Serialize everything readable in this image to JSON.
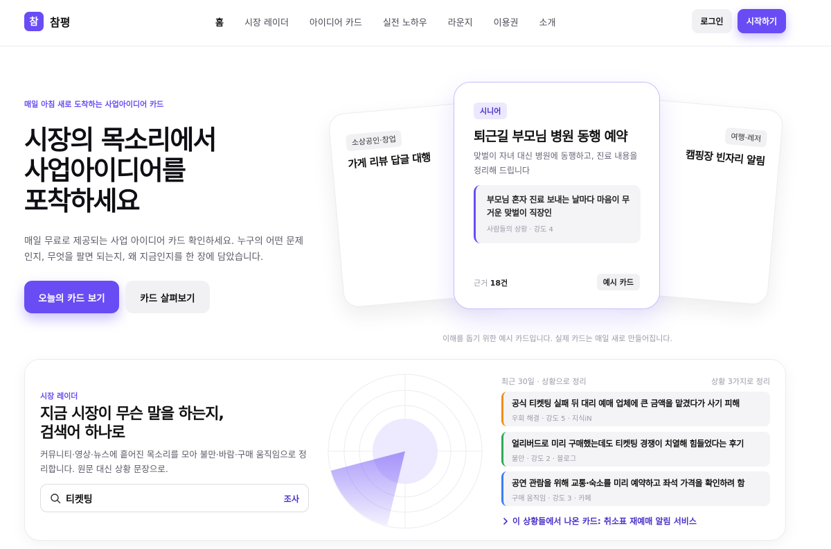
{
  "nav": {
    "logo_mark": "참",
    "logo_text": "참평",
    "menu": [
      "홈",
      "시장 레이더",
      "아이디어 카드",
      "실전 노하우",
      "라운지",
      "이용권",
      "소개"
    ],
    "login": "로그인",
    "start": "시작하기"
  },
  "hero": {
    "eyebrow": "매일 아침 새로 도착하는 사업아이디어 카드",
    "headline": [
      "시장의 목소리에서",
      "사업아이디어를",
      "포착하세요"
    ],
    "sub": "매일 무료로 제공되는 사업 아이디어 카드 확인하세요. 누구의 어떤 문제인지, 무엇을 팔면 되는지, 왜 지금인지를 한 장에 담았습니다.",
    "primary_btn": "오늘의 카드 보기",
    "secondary_btn": "카드 살펴보기",
    "note": "이해를 돕기 위한 예시 카드입니다. 실제 카드는 매일 새로 만들어집니다."
  },
  "cards": {
    "left": {
      "chip": "소상공인·창업",
      "title": "가게 리뷰 답글 대행"
    },
    "right": {
      "chip": "여행·레저",
      "title": "캠핑장 빈자리 알림"
    },
    "main": {
      "chip": "시니어",
      "title": "퇴근길 부모님 병원 동행 예약",
      "desc": "맞벌이 자녀 대신 병원에 동행하고, 진료 내용을 정리해 드립니다",
      "quote": "부모님 혼자 진료 보내는 날마다 마음이 무거운 맞벌이 직장인",
      "quote_meta": "사람들의 상황 · 강도 4",
      "count_label": "근거",
      "count_value": "18건",
      "badge": "예시 카드"
    }
  },
  "radar": {
    "eyebrow": "시장 레이더",
    "title": [
      "지금 시장이 무슨 말을 하는지,",
      "검색어 하나로"
    ],
    "desc": "커뮤니티·영상·뉴스에 흩어진 목소리를 모아 불만·바람·구매 움직임으로 정리합니다. 원문 대신 상황 문장으로.",
    "search_value": "티켓팅",
    "search_action": "조사",
    "head_left": "최근 30일 · 상황으로 정리",
    "head_right": "상황 3가지로 정리",
    "signals": [
      {
        "title": "공식 티켓팅 실패 뒤 대리 예매 업체에 큰 금액을 맡겼다가 사기 피해",
        "meta": "우회 해결 · 강도 5 · 지식iN",
        "color": "#f28c1b"
      },
      {
        "title": "얼리버드로 미리 구매했는데도 티켓팅 경쟁이 치열해 힘들었다는 후기",
        "meta": "불만 · 강도 2 · 블로그",
        "color": "#2eaa55"
      },
      {
        "title": "공연 관람을 위해 교통·숙소를 미리 예약하고 좌석 가격을 확인하려 함",
        "meta": "구매 움직임 · 강도 3 · 카페",
        "color": "#3a7cf5"
      }
    ],
    "link": "이 상황들에서 나온 카드: 취소표 재예매 알림 서비스"
  },
  "colors": {
    "accent": "#6a4cf5",
    "accent_dark": "#4a32c8"
  },
  "icons": {
    "search": "search-icon",
    "chevron": "chevron-right-icon"
  }
}
